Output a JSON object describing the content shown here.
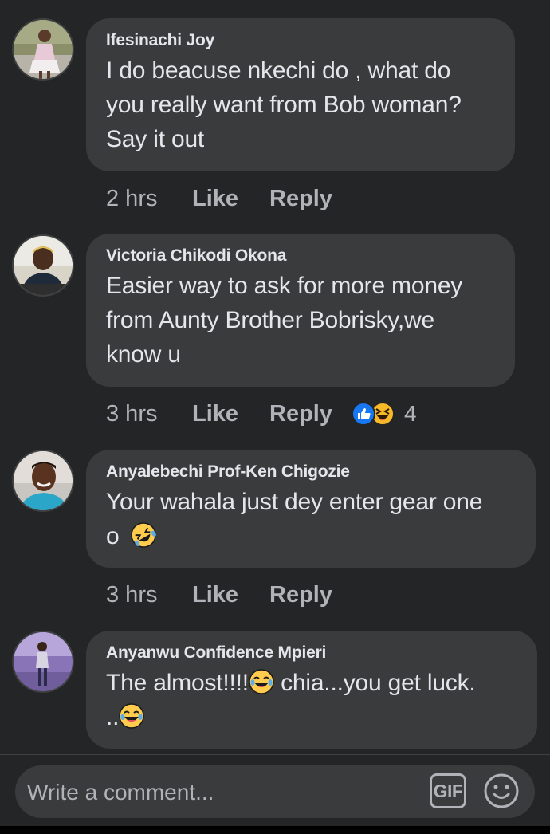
{
  "comments": [
    {
      "author": "Ifesinachi Joy",
      "lines": [
        "I do beacuse nkechi do , what do",
        "you really want from Bob woman?",
        "Say it out"
      ],
      "time": "2 hrs",
      "like_label": "Like",
      "reply_label": "Reply"
    },
    {
      "author": "Victoria Chikodi Okona",
      "lines": [
        "Easier way to ask for more money",
        "from Aunty Brother Bobrisky,we",
        "know u"
      ],
      "time": "3 hrs",
      "like_label": "Like",
      "reply_label": "Reply",
      "reaction_icons": [
        "like-reaction-icon",
        "haha-reaction-icon"
      ],
      "reaction_count": "4"
    },
    {
      "author": "Anyalebechi Prof-Ken Chigozie",
      "line1": "Your wahala just dey enter gear one",
      "line2_text": "o",
      "line2_emoji": "rolling-laughing-emoji",
      "time": "3 hrs",
      "like_label": "Like",
      "reply_label": "Reply"
    },
    {
      "author": "Anyanwu Confidence Mpieri",
      "line1_a": "The almost!!!!",
      "line1_emoji": "tears-of-joy-emoji",
      "line1_b": " chia...you get luck.",
      "line2_text": "..",
      "line2_emoji": "tears-of-joy-emoji"
    }
  ],
  "composer": {
    "placeholder": "Write a comment...",
    "gif_label": "GIF",
    "emoji_icon": "smiley-icon"
  },
  "colors": {
    "background": "#242526",
    "bubble": "#3a3b3c",
    "text": "#e4e6eb",
    "secondary_text": "#b0b3b8",
    "like_blue": "#1877f2",
    "haha_yellow": "#f7b928"
  }
}
